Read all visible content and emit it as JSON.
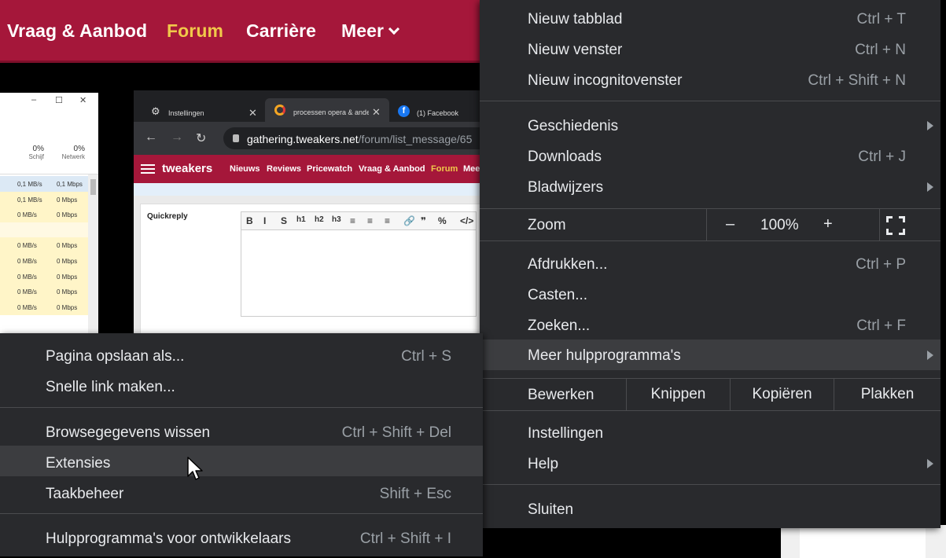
{
  "site": {
    "nav": [
      "Vraag & Aanbod",
      "Forum",
      "Carrière",
      "Meer"
    ],
    "active_nav": "Forum"
  },
  "taskmgr": {
    "columns": [
      {
        "pct": "0%",
        "name": "Schijf"
      },
      {
        "pct": "0%",
        "name": "Netwerk"
      }
    ],
    "rows": [
      [
        "0,1 MB/s",
        "0,1 Mbps"
      ],
      [
        "0,1 MB/s",
        "0 Mbps"
      ],
      [
        "0 MB/s",
        "0 Mbps"
      ],
      [
        "",
        ""
      ],
      [
        "0 MB/s",
        "0 Mbps"
      ],
      [
        "0 MB/s",
        "0 Mbps"
      ],
      [
        "0 MB/s",
        "0 Mbps"
      ],
      [
        "0 MB/s",
        "0 Mbps"
      ],
      [
        "0 MB/s",
        "0 Mbps"
      ]
    ]
  },
  "browser": {
    "tabs": [
      "Instellingen",
      "processen opera & ander",
      "(1) Facebook"
    ],
    "url_host": "gathering.tweakers.net",
    "url_path": "/forum/list_message/65",
    "tweakers_logo": "tweakers",
    "tweakers_nav": [
      "Nieuws",
      "Reviews",
      "Pricewatch",
      "Vraag & Aanbod",
      "Forum",
      "Mee"
    ],
    "quickreply_title": "Quickreply",
    "editor_buttons": [
      "B",
      "I",
      "S",
      "h1",
      "h2",
      "h3",
      "≡",
      "≡",
      "≡",
      "🔗",
      "❞",
      "%",
      "</>"
    ]
  },
  "main_menu": {
    "items_top": [
      {
        "label": "Nieuw tabblad",
        "shortcut": "Ctrl + T"
      },
      {
        "label": "Nieuw venster",
        "shortcut": "Ctrl + N"
      },
      {
        "label": "Nieuw incognitovenster",
        "shortcut": "Ctrl + Shift + N"
      }
    ],
    "items_history": [
      {
        "label": "Geschiedenis",
        "shortcut": ""
      },
      {
        "label": "Downloads",
        "shortcut": "Ctrl + J"
      },
      {
        "label": "Bladwijzers",
        "shortcut": ""
      }
    ],
    "zoom": {
      "label": "Zoom",
      "minus": "–",
      "value": "100%",
      "plus": "+"
    },
    "items_tools": [
      {
        "label": "Afdrukken...",
        "shortcut": "Ctrl + P"
      },
      {
        "label": "Casten...",
        "shortcut": ""
      },
      {
        "label": "Zoeken...",
        "shortcut": "Ctrl + F"
      },
      {
        "label": "Meer hulpprogramma's",
        "shortcut": ""
      }
    ],
    "edit": {
      "label": "Bewerken",
      "cut": "Knippen",
      "copy": "Kopiëren",
      "paste": "Plakken"
    },
    "items_settings": [
      {
        "label": "Instellingen",
        "shortcut": ""
      },
      {
        "label": "Help",
        "shortcut": ""
      }
    ],
    "exit": {
      "label": "Sluiten"
    }
  },
  "sub_menu": {
    "items": [
      {
        "label": "Pagina opslaan als...",
        "shortcut": "Ctrl + S"
      },
      {
        "label": "Snelle link maken...",
        "shortcut": ""
      },
      {
        "label": "Browsegegevens wissen",
        "shortcut": "Ctrl + Shift + Del"
      },
      {
        "label": "Extensies",
        "shortcut": ""
      },
      {
        "label": "Taakbeheer",
        "shortcut": "Shift + Esc"
      },
      {
        "label": "Hulpprogramma's voor ontwikkelaars",
        "shortcut": "Ctrl + Shift + I"
      }
    ]
  },
  "colors": {
    "brand": "#a5173a",
    "menu_bg": "#292a2d",
    "menu_highlight": "#3c3d40",
    "accent_nav": "#f0c84a"
  }
}
